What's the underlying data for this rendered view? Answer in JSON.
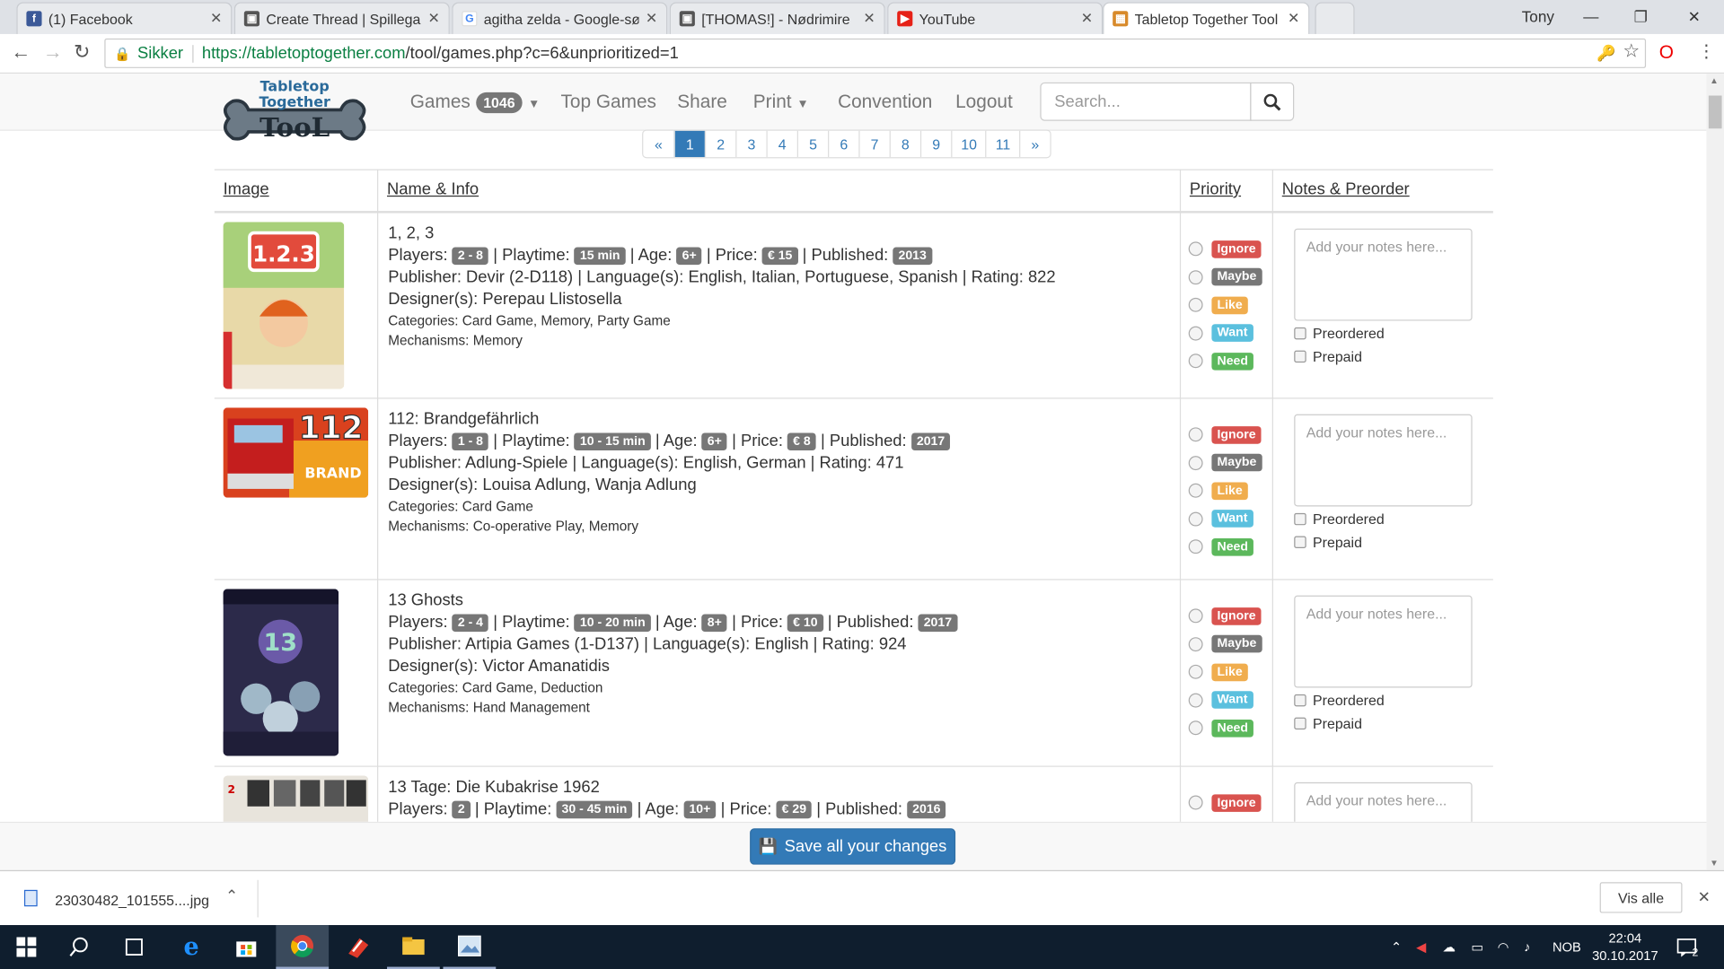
{
  "browser": {
    "tabs": [
      {
        "label": "(1) Facebook",
        "icon": "facebook-icon",
        "color": "#3b5998",
        "glyph": "f"
      },
      {
        "label": "Create Thread | Spillegal",
        "icon": "spillegal-icon",
        "color": "#555",
        "glyph": "▣"
      },
      {
        "label": "agitha zelda - Google-sø",
        "icon": "google-icon",
        "color": "#4285f4",
        "glyph": "G"
      },
      {
        "label": "[THOMAS!] - Nødrimire",
        "icon": "spillegal-icon",
        "color": "#555",
        "glyph": "▣"
      },
      {
        "label": "YouTube",
        "icon": "youtube-icon",
        "color": "#e62117",
        "glyph": "▶"
      },
      {
        "label": "Tabletop Together Tool",
        "icon": "tabletop-icon",
        "color": "#d88a2a",
        "glyph": "▦"
      }
    ],
    "user": "Tony",
    "secure_label": "Sikker",
    "url_host": "https://tabletoptogether.com",
    "url_path": "/tool/games.php?c=6&unprioritized=1"
  },
  "site": {
    "logo_line1": "Tabletop",
    "logo_line2": "Together",
    "logo_line3": "TooL",
    "nav": {
      "games": "Games",
      "games_count": "1046",
      "top_games": "Top Games",
      "share": "Share",
      "print": "Print",
      "convention": "Convention",
      "logout": "Logout"
    },
    "search_placeholder": "Search..."
  },
  "pagination": [
    "«",
    "1",
    "2",
    "3",
    "4",
    "5",
    "6",
    "7",
    "8",
    "9",
    "10",
    "11",
    "»"
  ],
  "table": {
    "headers": {
      "image": "Image",
      "name": "Name & Info",
      "priority": "Priority",
      "notes": "Notes & Preorder"
    },
    "priority_labels": [
      "Ignore",
      "Maybe",
      "Like",
      "Want",
      "Need"
    ],
    "priority_colors": [
      "#d9534f",
      "#777777",
      "#f0ad4e",
      "#5bc0de",
      "#5cb85c"
    ],
    "notes_placeholder": "Add your notes here...",
    "preordered": "Preordered",
    "prepaid": "Prepaid",
    "rows": [
      {
        "title": "1, 2, 3",
        "players": "2 - 8",
        "playtime": "15 min",
        "age": "6+",
        "price": "€ 15",
        "published": "2013",
        "publisher": "Devir (2-D118)",
        "languages": "English, Italian, Portuguese, Spanish",
        "rating": "822",
        "designers": "Perepau Llistosella",
        "categories": "Card Game, Memory, Party Game",
        "mechanisms": "Memory"
      },
      {
        "title": "112: Brandgefährlich",
        "players": "1 - 8",
        "playtime": "10 - 15 min",
        "age": "6+",
        "price": "€ 8",
        "published": "2017",
        "publisher": "Adlung-Spiele",
        "languages": "English, German",
        "rating": "471",
        "designers": "Louisa Adlung, Wanja Adlung",
        "categories": "Card Game",
        "mechanisms": "Co-operative Play, Memory"
      },
      {
        "title": "13 Ghosts",
        "players": "2 - 4",
        "playtime": "10 - 20 min",
        "age": "8+",
        "price": "€ 10",
        "published": "2017",
        "publisher": "Artipia Games (1-D137)",
        "languages": "English",
        "rating": "924",
        "designers": "Victor Amanatidis",
        "categories": "Card Game, Deduction",
        "mechanisms": "Hand Management"
      },
      {
        "title": "13 Tage: Die Kubakrise 1962",
        "players": "2",
        "playtime": "30 - 45 min",
        "age": "10+",
        "price": "€ 29",
        "published": "2016"
      }
    ],
    "field_labels": {
      "players": "Players:",
      "playtime": "Playtime:",
      "age": "Age:",
      "price": "Price:",
      "published": "Published:",
      "publisher": "Publisher:",
      "languages": "Language(s):",
      "rating": "Rating:",
      "designers": "Designer(s):",
      "categories": "Categories:",
      "mechanisms": "Mechanisms:"
    }
  },
  "save_button": "Save all your changes",
  "download": {
    "file": "23030482_101555....jpg",
    "show_all": "Vis alle"
  },
  "taskbar": {
    "lang": "NOB",
    "time": "22:04",
    "date": "30.10.2017",
    "notif": "2"
  }
}
